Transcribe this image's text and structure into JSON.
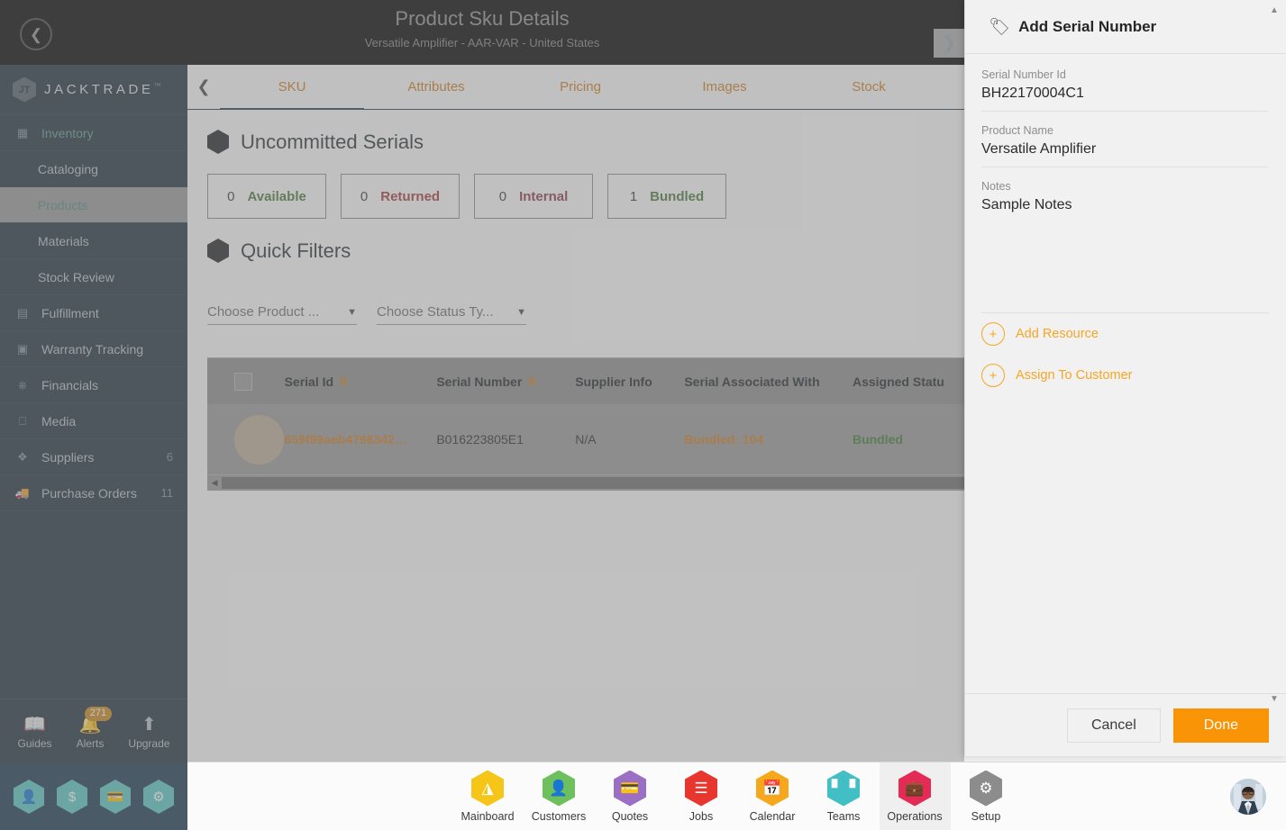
{
  "header": {
    "title": "Product Sku Details",
    "subtitle": "Versatile Amplifier - AAR-VAR - United States",
    "back_icon": "chevron-left-icon",
    "next_icon": "chevron-right-icon"
  },
  "brand": {
    "name": "JACKTRADE",
    "tm": "™",
    "mark": "JT"
  },
  "sidebar": {
    "items": [
      {
        "label": "Inventory",
        "icon": "inventory-icon",
        "type": "group",
        "badge": ""
      },
      {
        "label": "Cataloging",
        "icon": "",
        "type": "sub",
        "badge": ""
      },
      {
        "label": "Products",
        "icon": "",
        "type": "sub",
        "badge": "",
        "active": true
      },
      {
        "label": "Materials",
        "icon": "",
        "type": "sub",
        "badge": ""
      },
      {
        "label": "Stock Review",
        "icon": "",
        "type": "sub",
        "badge": ""
      },
      {
        "label": "Fulfillment",
        "icon": "fulfillment-icon",
        "type": "main",
        "badge": ""
      },
      {
        "label": "Warranty Tracking",
        "icon": "warranty-icon",
        "type": "main",
        "badge": ""
      },
      {
        "label": "Financials",
        "icon": "financials-icon",
        "type": "main",
        "badge": ""
      },
      {
        "label": "Media",
        "icon": "media-icon",
        "type": "main",
        "badge": ""
      },
      {
        "label": "Suppliers",
        "icon": "suppliers-icon",
        "type": "main",
        "badge": "6"
      },
      {
        "label": "Purchase Orders",
        "icon": "purchase-icon",
        "type": "main",
        "badge": "11"
      }
    ],
    "tools": [
      {
        "label": "Guides",
        "icon": "book-icon",
        "count": ""
      },
      {
        "label": "Alerts",
        "icon": "bell-icon",
        "count": "271"
      },
      {
        "label": "Upgrade",
        "icon": "arrow-up-icon",
        "count": ""
      }
    ],
    "quick_hexes": [
      {
        "icon": "person-icon",
        "glyph": "\u0001"
      },
      {
        "icon": "dollar-icon",
        "glyph": "$"
      },
      {
        "icon": "payment-icon",
        "glyph": "\u0001"
      },
      {
        "icon": "workflow-icon",
        "glyph": "\u0001"
      }
    ]
  },
  "main": {
    "tabs": [
      {
        "label": "SKU",
        "active": true
      },
      {
        "label": "Attributes",
        "active": false
      },
      {
        "label": "Pricing",
        "active": false
      },
      {
        "label": "Images",
        "active": false
      },
      {
        "label": "Stock",
        "active": false
      }
    ],
    "section_title": "Uncommitted Serials",
    "stats": [
      {
        "count": "0",
        "label": "Available",
        "color": "green"
      },
      {
        "count": "0",
        "label": "Returned",
        "color": "red"
      },
      {
        "count": "0",
        "label": "Internal",
        "color": "mag"
      },
      {
        "count": "1",
        "label": "Bundled",
        "color": "green"
      }
    ],
    "filters_title": "Quick Filters",
    "filters": [
      {
        "placeholder": "Choose Product ...",
        "value": ""
      },
      {
        "placeholder": "Choose Status Ty...",
        "value": ""
      }
    ],
    "table": {
      "columns": [
        "Serial Id",
        "Serial Number",
        "Supplier Info",
        "Serial Associated With",
        "Assigned Statu"
      ],
      "rows": [
        {
          "serial_id": "659f99aeb4798342…",
          "serial_number": "B016223805E1",
          "supplier_info": "N/A",
          "associated_with": "Bundled: 104",
          "assigned_status": "Bundled"
        }
      ]
    }
  },
  "drawer": {
    "title": "Add Serial Number",
    "icon": "tag-icon",
    "fields": [
      {
        "label": "Serial Number Id",
        "value": "BH22170004C1"
      },
      {
        "label": "Product Name",
        "value": "Versatile Amplifier"
      },
      {
        "label": "Notes",
        "value": "Sample Notes"
      }
    ],
    "actions": [
      {
        "label": "Add Resource",
        "icon": "plus-circle-icon"
      },
      {
        "label": "Assign To Customer",
        "icon": "plus-circle-icon"
      }
    ],
    "cancel_label": "Cancel",
    "done_label": "Done"
  },
  "bottom_nav": {
    "items": [
      {
        "label": "Mainboard",
        "icon": "mainboard-icon",
        "color": "#f5c518",
        "selected": false
      },
      {
        "label": "Customers",
        "icon": "customers-icon",
        "color": "#6ec05f",
        "selected": false
      },
      {
        "label": "Quotes",
        "icon": "quotes-icon",
        "color": "#9b6fc4",
        "selected": false
      },
      {
        "label": "Jobs",
        "icon": "jobs-icon",
        "color": "#e8352e",
        "selected": false
      },
      {
        "label": "Calendar",
        "icon": "calendar-icon",
        "color": "#f5a81c",
        "selected": false
      },
      {
        "label": "Teams",
        "icon": "teams-icon",
        "color": "#41bfc4",
        "selected": false
      },
      {
        "label": "Operations",
        "icon": "operations-icon",
        "color": "#e32b56",
        "selected": true
      },
      {
        "label": "Setup",
        "icon": "setup-icon",
        "color": "#8c8c8c",
        "selected": false
      }
    ],
    "avatar": "user-avatar"
  },
  "colors": {
    "accent_orange": "#f89406",
    "sidebar_bg": "#22333f",
    "header_bg": "#131313",
    "link_orange": "#cf7c20"
  }
}
